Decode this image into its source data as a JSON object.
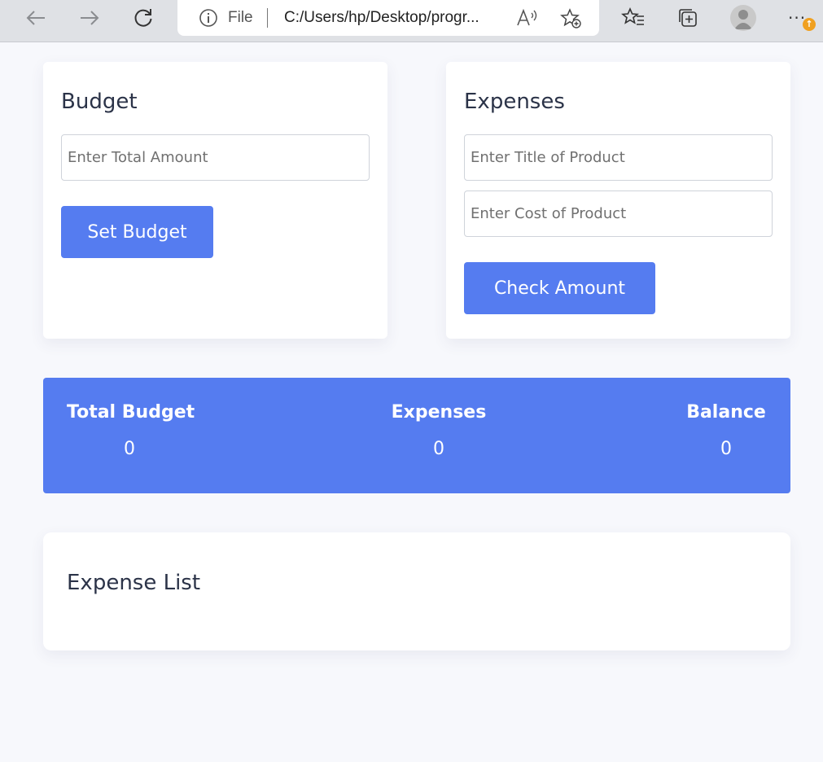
{
  "browser": {
    "address_prefix": "File",
    "url": "C:/Users/hp/Desktop/progr...",
    "more_label": "···",
    "notification_badge": "↑",
    "accent_color": "#f0a020"
  },
  "budget": {
    "title": "Budget",
    "amount_placeholder": "Enter Total Amount",
    "set_button": "Set Budget"
  },
  "expenses_form": {
    "title": "Expenses",
    "title_placeholder": "Enter Title of Product",
    "cost_placeholder": "Enter Cost of Product",
    "check_button": "Check Amount"
  },
  "summary": {
    "total_budget_label": "Total Budget",
    "total_budget_value": "0",
    "expenses_label": "Expenses",
    "expenses_value": "0",
    "balance_label": "Balance",
    "balance_value": "0"
  },
  "expense_list": {
    "title": "Expense List"
  },
  "colors": {
    "primary": "#557cf0",
    "page_bg": "#f7f8fc",
    "heading": "#2b3348"
  }
}
